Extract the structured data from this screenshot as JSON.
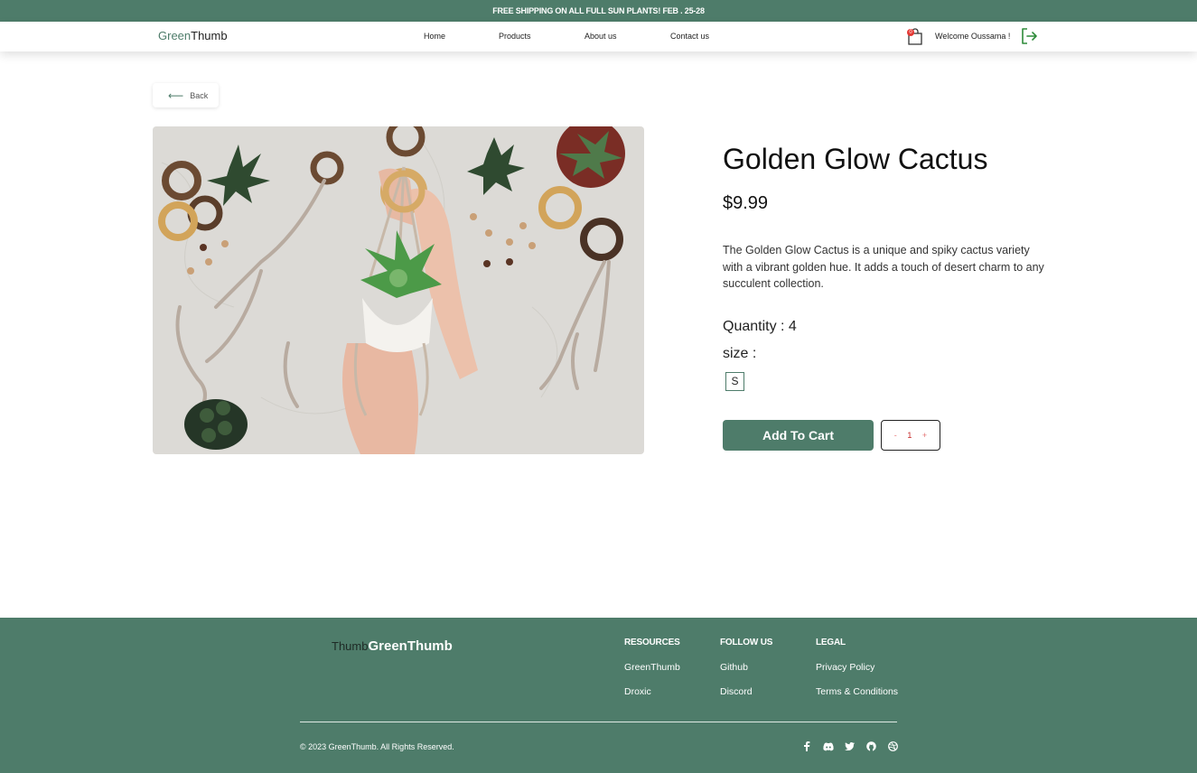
{
  "promo": {
    "text": "FREE SHIPPING ON ALL FULL SUN PLANTS! FEB . 25-28"
  },
  "nav": {
    "logo_a": "Green",
    "logo_b": "Thumb",
    "links": [
      "Home",
      "Products",
      "About us",
      "Contact us"
    ],
    "cart_count": "0",
    "welcome": "Welcome Oussama !"
  },
  "back": {
    "label": "Back"
  },
  "product": {
    "title": "Golden Glow Cactus",
    "price": "$9.99",
    "description": "The Golden Glow Cactus is a unique and spiky cactus variety with a vibrant golden hue. It adds a touch of desert charm to any succulent collection.",
    "quantity_label": "Quantity : 4",
    "size_label": "size :",
    "size_option": "S",
    "add_to_cart": "Add To Cart",
    "stepper": {
      "minus": "-",
      "value": "1",
      "plus": "+"
    }
  },
  "footer": {
    "logo_thumb": "Thumb",
    "logo_brand": "GreenThumb",
    "columns": [
      {
        "title": "RESOURCES",
        "links": [
          "GreenThumb",
          "Droxic"
        ]
      },
      {
        "title": "FOLLOW US",
        "links": [
          "Github",
          "Discord"
        ]
      },
      {
        "title": "LEGAL",
        "links": [
          "Privacy Policy",
          "Terms & Conditions"
        ]
      }
    ],
    "copyright": "© 2023 GreenThumb. All Rights Reserved.",
    "socials": [
      "facebook-icon",
      "discord-icon",
      "twitter-icon",
      "github-icon",
      "dribbble-icon"
    ]
  },
  "colors": {
    "brand": "#4e7c6a",
    "badge": "#e53935"
  }
}
